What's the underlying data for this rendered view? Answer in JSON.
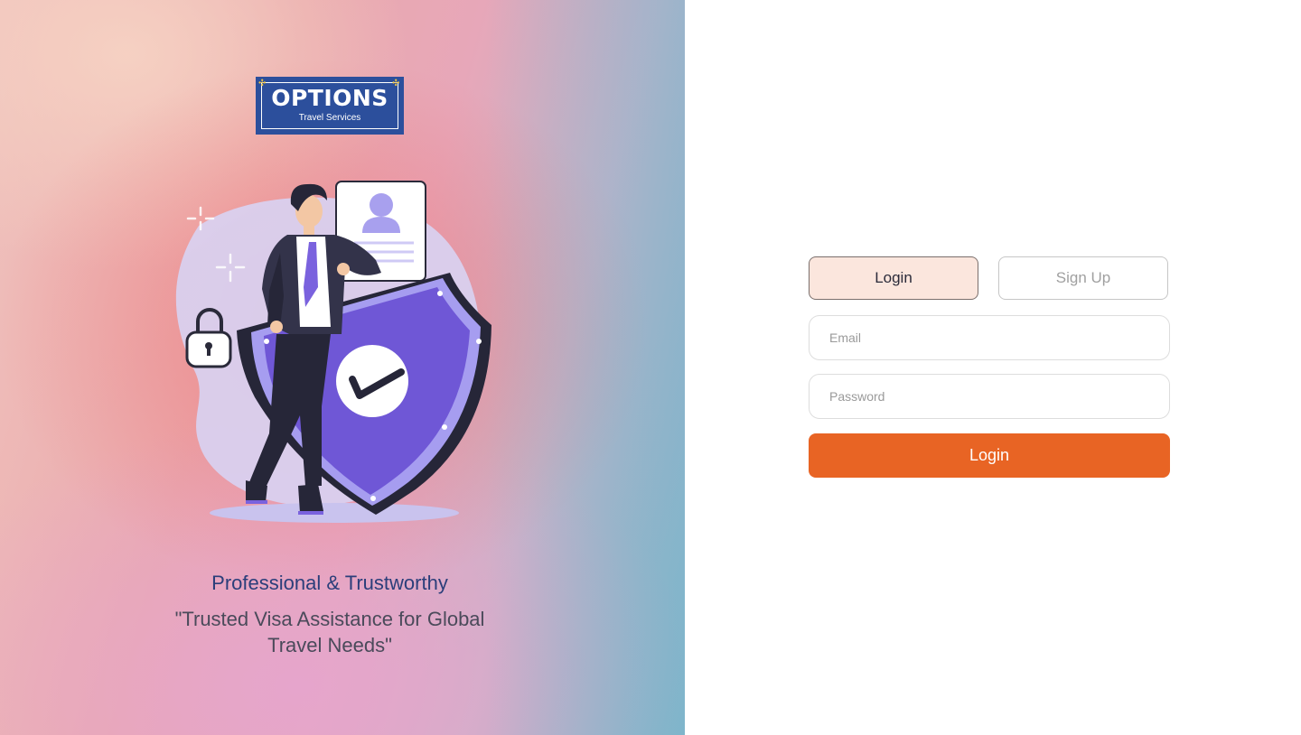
{
  "brand": {
    "logo_title": "OPTIONS",
    "logo_subtitle": "Travel Services",
    "colors": {
      "logo_bg": "#2c4f9c",
      "accent": "#e86424",
      "tab_active_bg": "#fbe6dd"
    }
  },
  "hero": {
    "illustration_icon": "businessman-with-security-shield-illustration",
    "title": "Professional & Trustworthy",
    "quote_line1": "\"Trusted Visa Assistance for Global",
    "quote_line2": "Travel Needs\""
  },
  "auth": {
    "tabs": [
      {
        "label": "Login",
        "active": true
      },
      {
        "label": "Sign Up",
        "active": false
      }
    ],
    "email_placeholder": "Email",
    "password_placeholder": "Password",
    "submit_label": "Login"
  }
}
